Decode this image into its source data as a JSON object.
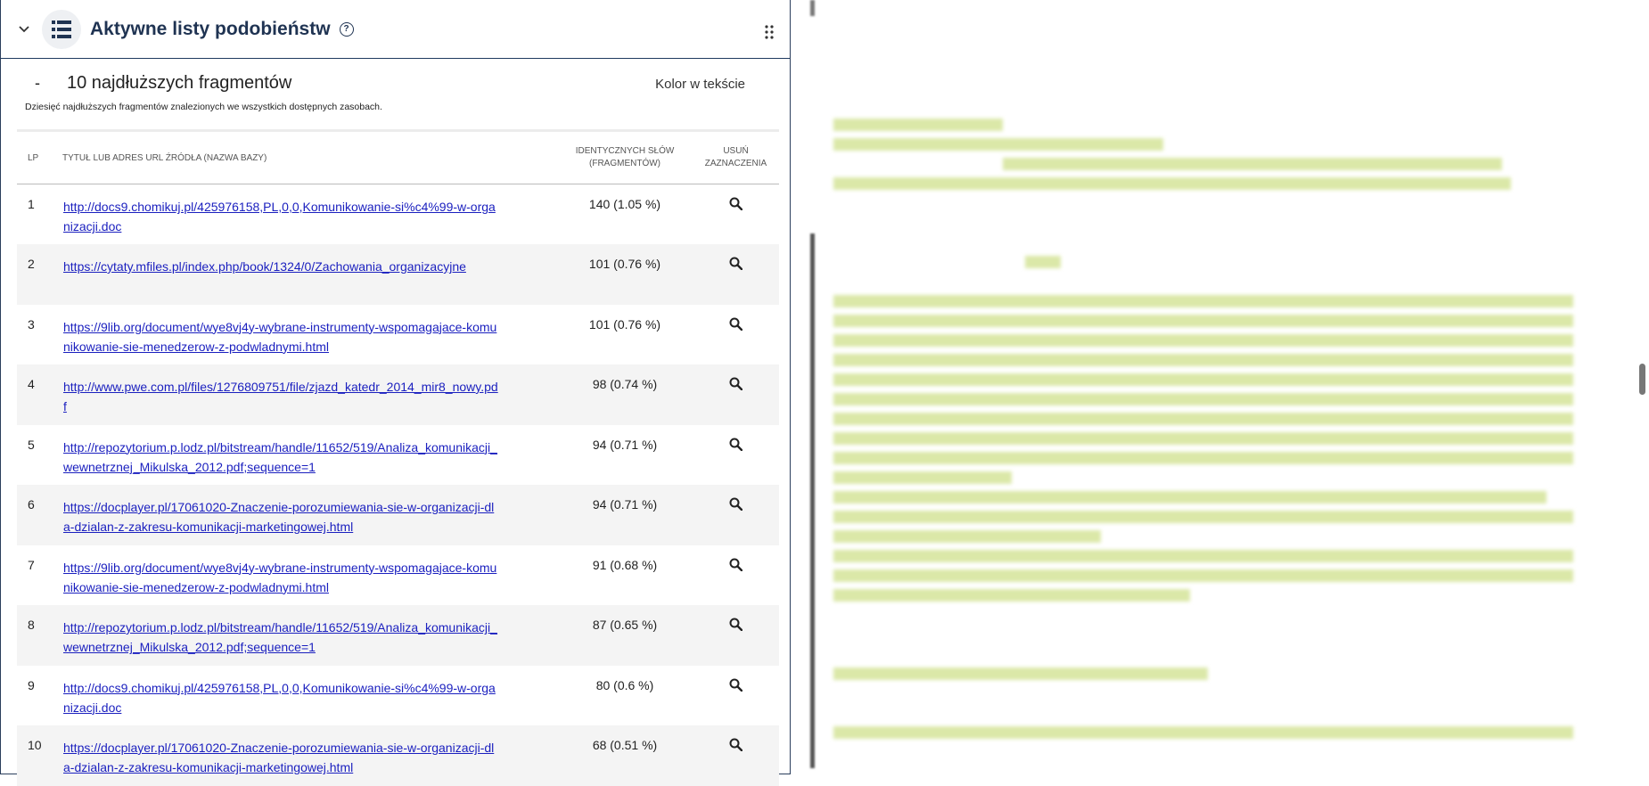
{
  "panel": {
    "title": "Aktywne listy podobieństw",
    "help": "?",
    "section_dash": "-",
    "section_title": "10 najdłuższych fragmentów",
    "color_label": "Kolor w tekście",
    "description": "Dziesięć najdłuższych fragmentów znalezionych we wszystkich dostępnych zasobach."
  },
  "table": {
    "headers": {
      "lp": "LP",
      "title": "TYTUŁ LUB ADRES URL ŹRÓDŁA (NAZWA BAZY)",
      "words_line1": "IDENTYCZNYCH SŁÓW",
      "words_line2": "(FRAGMENTÓW)",
      "delete_line1": "USUŃ",
      "delete_line2": "ZAZNACZENIA"
    },
    "rows": [
      {
        "lp": "1",
        "url": "http://docs9.chomikuj.pl/425976158,PL,0,0,Komunikowanie-si%c4%99-w-organizacji.doc",
        "words": "140  (1.05 %)"
      },
      {
        "lp": "2",
        "url": "https://cytaty.mfiles.pl/index.php/book/1324/0/Zachowania_organizacyjne",
        "words": "101  (0.76 %)"
      },
      {
        "lp": "3",
        "url": "https://9lib.org/document/wye8vj4y-wybrane-instrumenty-wspomagajace-komunikowanie-sie-menedzerow-z-podwladnymi.html",
        "words": "101  (0.76 %)"
      },
      {
        "lp": "4",
        "url": "http://www.pwe.com.pl/files/1276809751/file/zjazd_katedr_2014_mir8_nowy.pdf",
        "words": "98  (0.74 %)"
      },
      {
        "lp": "5",
        "url": "http://repozytorium.p.lodz.pl/bitstream/handle/11652/519/Analiza_komunikacji_wewnetrznej_Mikulska_2012.pdf;sequence=1",
        "words": "94  (0.71 %)"
      },
      {
        "lp": "6",
        "url": "https://docplayer.pl/17061020-Znaczenie-porozumiewania-sie-w-organizacji-dla-dzialan-z-zakresu-komunikacji-marketingowej.html",
        "words": "94  (0.71 %)"
      },
      {
        "lp": "7",
        "url": "https://9lib.org/document/wye8vj4y-wybrane-instrumenty-wspomagajace-komunikowanie-sie-menedzerow-z-podwladnymi.html",
        "words": "91  (0.68 %)"
      },
      {
        "lp": "8",
        "url": "http://repozytorium.p.lodz.pl/bitstream/handle/11652/519/Analiza_komunikacji_wewnetrznej_Mikulska_2012.pdf;sequence=1",
        "words": "87  (0.65 %)"
      },
      {
        "lp": "9",
        "url": "http://docs9.chomikuj.pl/425976158,PL,0,0,Komunikowanie-si%c4%99-w-organizacji.doc",
        "words": "80  (0.6 %)"
      },
      {
        "lp": "10",
        "url": "https://docplayer.pl/17061020-Znaczenie-porozumiewania-sie-w-organizacji-dla-dzialan-z-zakresu-komunikacji-marketingowej.html",
        "words": "68  (0.51 %)"
      }
    ]
  },
  "icons": {
    "collapse": "chevron-down-icon",
    "list": "list-icon",
    "drag": "drag-handle-icon",
    "search": "search-icon"
  },
  "colors": {
    "navy": "#1f3352",
    "link": "#1a1fbf",
    "highlight": "#dbe8a8"
  }
}
